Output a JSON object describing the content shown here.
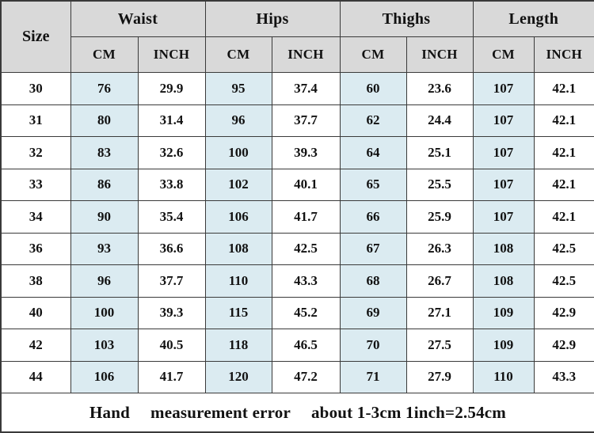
{
  "table": {
    "size_header": "Size",
    "groups": [
      {
        "label": "Waist"
      },
      {
        "label": "Hips"
      },
      {
        "label": "Thighs"
      },
      {
        "label": "Length"
      }
    ],
    "units": [
      "CM",
      "INCH",
      "CM",
      "INCH",
      "CM",
      "INCH",
      "CM",
      "INCH"
    ],
    "rows": [
      {
        "size": "30",
        "waist_cm": "76",
        "waist_in": "29.9",
        "hips_cm": "95",
        "hips_in": "37.4",
        "thighs_cm": "60",
        "thighs_in": "23.6",
        "length_cm": "107",
        "length_in": "42.1"
      },
      {
        "size": "31",
        "waist_cm": "80",
        "waist_in": "31.4",
        "hips_cm": "96",
        "hips_in": "37.7",
        "thighs_cm": "62",
        "thighs_in": "24.4",
        "length_cm": "107",
        "length_in": "42.1"
      },
      {
        "size": "32",
        "waist_cm": "83",
        "waist_in": "32.6",
        "hips_cm": "100",
        "hips_in": "39.3",
        "thighs_cm": "64",
        "thighs_in": "25.1",
        "length_cm": "107",
        "length_in": "42.1"
      },
      {
        "size": "33",
        "waist_cm": "86",
        "waist_in": "33.8",
        "hips_cm": "102",
        "hips_in": "40.1",
        "thighs_cm": "65",
        "thighs_in": "25.5",
        "length_cm": "107",
        "length_in": "42.1"
      },
      {
        "size": "34",
        "waist_cm": "90",
        "waist_in": "35.4",
        "hips_cm": "106",
        "hips_in": "41.7",
        "thighs_cm": "66",
        "thighs_in": "25.9",
        "length_cm": "107",
        "length_in": "42.1"
      },
      {
        "size": "36",
        "waist_cm": "93",
        "waist_in": "36.6",
        "hips_cm": "108",
        "hips_in": "42.5",
        "thighs_cm": "67",
        "thighs_in": "26.3",
        "length_cm": "108",
        "length_in": "42.5"
      },
      {
        "size": "38",
        "waist_cm": "96",
        "waist_in": "37.7",
        "hips_cm": "110",
        "hips_in": "43.3",
        "thighs_cm": "68",
        "thighs_in": "26.7",
        "length_cm": "108",
        "length_in": "42.5"
      },
      {
        "size": "40",
        "waist_cm": "100",
        "waist_in": "39.3",
        "hips_cm": "115",
        "hips_in": "45.2",
        "thighs_cm": "69",
        "thighs_in": "27.1",
        "length_cm": "109",
        "length_in": "42.9"
      },
      {
        "size": "42",
        "waist_cm": "103",
        "waist_in": "40.5",
        "hips_cm": "118",
        "hips_in": "46.5",
        "thighs_cm": "70",
        "thighs_in": "27.5",
        "length_cm": "109",
        "length_in": "42.9"
      },
      {
        "size": "44",
        "waist_cm": "106",
        "waist_in": "41.7",
        "hips_cm": "120",
        "hips_in": "47.2",
        "thighs_cm": "71",
        "thighs_in": "27.9",
        "length_cm": "110",
        "length_in": "43.3"
      }
    ],
    "footer": {
      "part1": "Hand",
      "part2": "measurement error",
      "part3": "about 1-3cm 1inch=2.54cm"
    }
  },
  "colors": {
    "header_gray": "#d9d9d9",
    "cm_highlight": "#dbebf1",
    "border": "#3a3a3a",
    "text": "#111111"
  }
}
